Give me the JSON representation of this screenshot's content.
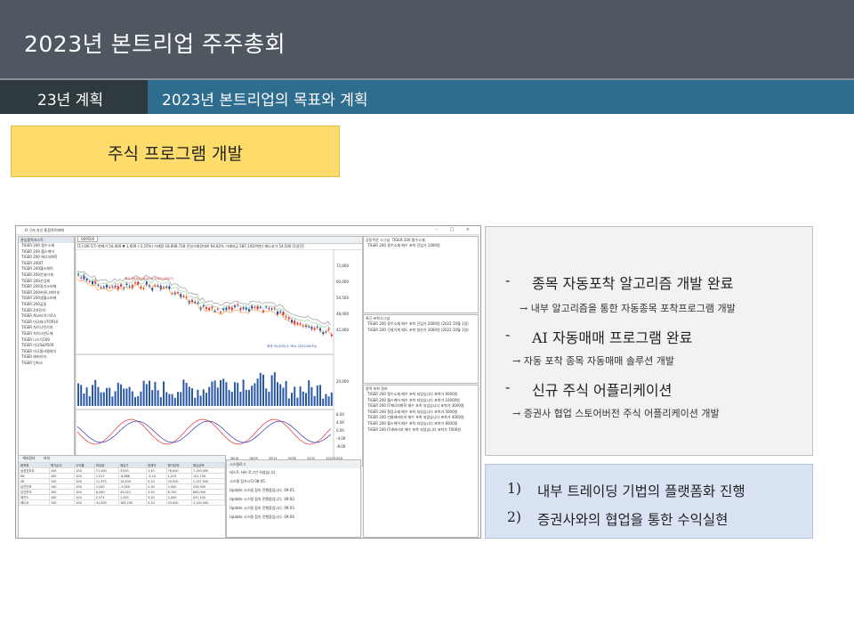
{
  "slide": {
    "title": "2023년 본트리업 주주총회",
    "section_label": "23년 계획",
    "section_title": "2023년 본트리업의 목표와 계획",
    "topic": "주식 프로그램 개발"
  },
  "app_window": {
    "title": "Ο 구자 자신 통합차트매매",
    "window_controls": "– □ ×",
    "toolbar_code": "069500",
    "chart_info_line": "[1] (06-57) 현재가 54,400 ▼ 1,000 (-2.25%) 거래량 18,808,718 전일거래량대비 64.82% 거래대금 587,141(백만) 매도호가 54,500 [1일]전",
    "left_list": {
      "header": "관심종목리스트",
      "items": [
        "TIGER 200 필수소재",
        "TIGER 200 헬스케어",
        "TIGER 200 에너지화학",
        "TIGER 200IT",
        "TIGER 200헬스케어",
        "TIGER 200건설기계",
        "TIGER 200산업재",
        "TIGER 200경기소비재",
        "TIGER 200커뮤니케이션",
        "TIGER 200생활소비재",
        "TIGER 200금융",
        "TIGER 2차전지",
        "TIGER AI코리아그로스",
        "TIGER 미국테크TOP10",
        "TIGER 차이나전기차",
        "TIGER 차이나반도체",
        "TIGER 나스닥100",
        "TIGER 미국S&P500",
        "TIGER 미국필라델피아",
        "TIGER 레버리지",
        "TIGER 인버스"
      ]
    },
    "chart": {
      "price_labels": [
        "72,000",
        "60,000",
        "54,500",
        "48,000",
        "42,000"
      ],
      "volume_labels": [
        "20,000"
      ],
      "osc_labels": [
        "8.00",
        "4.00",
        "0.00",
        "-4.00",
        "-8.00"
      ],
      "x_dates": [
        "2022/04/18",
        "05/02",
        "05/16",
        "06/07",
        "06/20",
        "07/04",
        "07/18",
        "08/01",
        "08/16",
        "08/29",
        "09/13",
        "09/26",
        "10/10",
        "2022/10/18"
      ],
      "high_note": "최고 68,000(6.47% 2022/05/07)",
      "low_note": "최저 50,000(-4.76% 2022/09/30)"
    },
    "right_panels": {
      "p1_title": "공동주문 시그널",
      "p1_head": "TIGER 200 필수소재",
      "p1_lines": [
        "TIGER 200 필수소재 매수 포착 진입가 1000원"
      ],
      "p2_title": "최근 포착시그널",
      "p2_lines": [
        "TIGER 200 필수소재 매수 포착 진입가 2000원 (2022.10월 1일)",
        "TIGER 200 건설기계 매도 포착 청산가 3000원 (2022.10월 1일)"
      ],
      "p3_title": "종목 포착 정보",
      "p3_lines": [
        "TIGER 200 필수소재 매수 포착 되었습니다 포착가 6000원",
        "TIGER 200 헬스케어 매수 포착 되었습니다 포착가 10000원",
        "TIGER 200 IT에너지화학 매수 포착 되었습니다 포착가 3000원",
        "TIGER 200 철강소재 매수 포착 되었습니다 포착가 5000원",
        "TIGER 200 선물레버리지 매수 포착 되었습니다 포착가 4000원",
        "TIGER 200 헬스케어 매수 포착 되었습니다 포착가 6000원",
        "TIGER 200 IT레버리지 매수 포착 되었습니다 포착가 7000원"
      ]
    },
    "log_panel": {
      "title": "시스템로그",
      "lines": [
        "테스트 서버 로그인 하셨습니다.",
        "시스템 접속시작 08:45.",
        "Update 시스템 접속 진행중입니다. 09:01.",
        "Update 시스템 접속 진행중입니다. 09:02.",
        "Update 시스템 접속 진행중입니다. 09:03.",
        "Update 시스템 접속 진행중입니다. 09:04."
      ]
    },
    "portfolio": {
      "tabs": [
        "계좌정보",
        "보유"
      ],
      "header": [
        "종목명",
        "평가손익",
        "수익률",
        "보유량",
        "매입가",
        "현재가",
        "평가금액",
        "매입금액"
      ],
      "rows": [
        [
          "삼성전자우",
          "100",
          "100",
          "71,500",
          "3,000",
          "1.40",
          "76,000",
          "7,150,000"
        ],
        [
          "KB",
          "100",
          "100",
          "1,017",
          "-6,886",
          "-3.10",
          "1,015",
          "101,700"
        ],
        [
          "SK",
          "100",
          "100",
          "11,975",
          "14,400",
          "5.10",
          "20,000",
          "1,197,500"
        ],
        [
          "유진인조",
          "100",
          "100",
          "2,540",
          "-3,000",
          "2.30",
          "2,000",
          "254,000"
        ],
        [
          "유진투자",
          "100",
          "100",
          "6,000",
          "43,022",
          "3.20",
          "8,700",
          "600,000"
        ],
        [
          "메가스",
          "100",
          "100",
          "2,571",
          "1,925",
          "3.30",
          "2,000",
          "257,100"
        ],
        [
          "메디서",
          "100",
          "100",
          "31,000",
          "183,290",
          "5.10",
          "33,000",
          "3,100,000"
        ]
      ]
    }
  },
  "achievements": [
    {
      "bullet": "-",
      "title": "종목 자동포착 알고리즘 개발 완료",
      "detail": "→ 내부 알고리즘을 통한 자동종목 포착프로그램 개발"
    },
    {
      "bullet": "-",
      "title": "AI 자동매매 프로그램 완료",
      "detail": "→ 자동 포착 종목 자동매매 솔루션 개발"
    },
    {
      "bullet": "-",
      "title": "신규 주식 어플리케이션",
      "detail": "→ 증권사 협업 스토어버전 주식 어플리케이션 개발"
    }
  ],
  "plans": [
    {
      "num": "1)",
      "text": "내부 트레이딩 기법의 플랫폼화 진행"
    },
    {
      "num": "2)",
      "text": "증권사와의 협업을 통한 수익실현"
    }
  ],
  "colors": {
    "title_bg": "#4f5861",
    "section_left_bg": "#2f3a3e",
    "section_right_bg": "#2e6d8f",
    "topic_bg": "#fedc6b",
    "gray_box": "#f2f2f2",
    "blue_box": "#dae3f3",
    "candle_up": "#e0262a",
    "candle_down": "#1f4ea8"
  }
}
